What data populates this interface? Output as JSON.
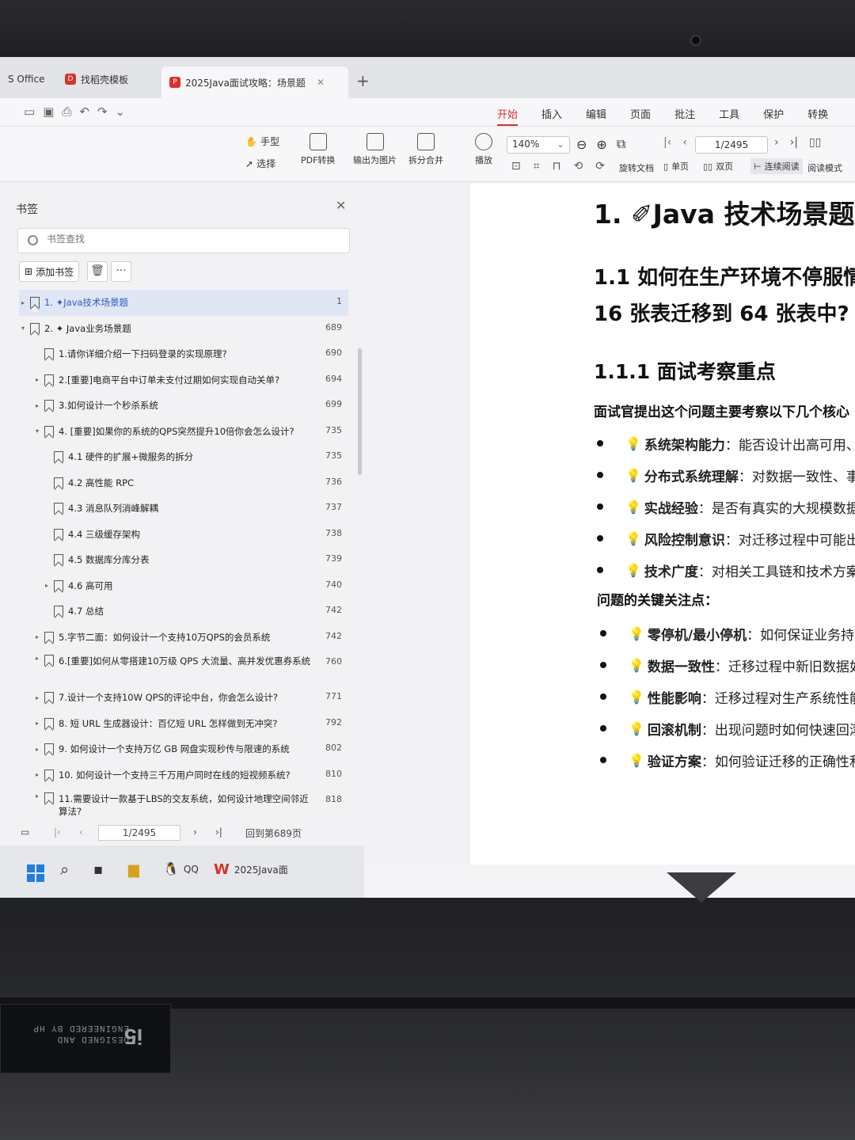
{
  "tabs": [
    {
      "label": "S Office"
    },
    {
      "label": "找稻壳模板"
    },
    {
      "label": "2025Java面试攻略：场景题"
    }
  ],
  "menu": [
    "开始",
    "插入",
    "编辑",
    "页面",
    "批注",
    "工具",
    "保护",
    "转换"
  ],
  "toolbar": {
    "hand": "手型",
    "select": "选择",
    "pdf_convert": "PDF转换",
    "export_image": "输出为图片",
    "split_merge": "拆分合并",
    "play": "播放",
    "zoom": "140%",
    "rotate": "旋转文档",
    "single": "单页",
    "double": "双页",
    "continuous": "连续阅读",
    "read_mode": "阅读模式",
    "page": "1/2495"
  },
  "bookmark_panel": {
    "title": "书签",
    "search_placeholder": "书签查找",
    "add_label": "添加书签",
    "items": [
      {
        "label": "1. ✦Java技术场景题",
        "page": "1"
      },
      {
        "label": "2. ✦ Java业务场景题",
        "page": "689"
      },
      {
        "label": "1.请你详细介绍一下扫码登录的实现原理?",
        "page": "690"
      },
      {
        "label": "2.[重要]电商平台中订单未支付过期如何实现自动关单?",
        "page": "694"
      },
      {
        "label": "3.如何设计一个秒杀系统",
        "page": "699"
      },
      {
        "label": "4. [重要]如果你的系统的QPS突然提升10倍你会怎么设计?",
        "page": "735"
      },
      {
        "label": "4.1 硬件的扩展+微服务的拆分",
        "page": "735"
      },
      {
        "label": "4.2 高性能 RPC",
        "page": "736"
      },
      {
        "label": "4.3 消息队列消峰解耦",
        "page": "737"
      },
      {
        "label": "4.4 三级缓存架构",
        "page": "738"
      },
      {
        "label": "4.5 数据库分库分表",
        "page": "739"
      },
      {
        "label": "4.6 高可用",
        "page": "740"
      },
      {
        "label": "4.7 总结",
        "page": "742"
      },
      {
        "label": "5.字节二面：如何设计一个支持10万QPS的会员系统",
        "page": "742"
      },
      {
        "label": "6.[重要]如何从零搭建10万级 QPS 大流量、高并发优惠券系统",
        "page": "760"
      },
      {
        "label": "7.设计一个支持10W QPS的评论中台，你会怎么设计?",
        "page": "771"
      },
      {
        "label": "8. 短 URL 生成器设计：百亿短 URL 怎样做到无冲突?",
        "page": "792"
      },
      {
        "label": "9. 如何设计一个支持万亿 GB 网盘实现秒传与限速的系统",
        "page": "802"
      },
      {
        "label": "10. 如何设计一个支持三千万用户同时在线的短视频系统?",
        "page": "810"
      },
      {
        "label": "11.需要设计一款基于LBS的交友系统，如何设计地理空间邻近算法?",
        "page": "818"
      }
    ],
    "pager_value": "1/2495",
    "goto_label": "回到第689页"
  },
  "taskbar": {
    "qq": "QQ",
    "wps": "2025Java面"
  },
  "document": {
    "h1": "1.  ✐Java 技术场景题",
    "h2_line1": "1.1  如何在生产环境不停服情",
    "h2_line2": "16 张表迁移到 64 张表中?",
    "h3": "1.1.1  面试考察重点",
    "lead": "面试官提出这个问题主要考察以下几个核心",
    "points": [
      {
        "b": "系统架构能力",
        "t": "：能否设计出高可用、"
      },
      {
        "b": "分布式系统理解",
        "t": "：对数据一致性、事"
      },
      {
        "b": "实战经验",
        "t": "：是否有真实的大规模数据"
      },
      {
        "b": "风险控制意识",
        "t": "：对迁移过程中可能出"
      },
      {
        "b": "技术广度",
        "t": "：对相关工具链和技术方案"
      }
    ],
    "lead2": "问题的关键关注点：",
    "points2": [
      {
        "b": "零停机/最小停机",
        "t": "：如何保证业务持"
      },
      {
        "b": "数据一致性",
        "t": "：迁移过程中新旧数据如"
      },
      {
        "b": "性能影响",
        "t": "：迁移过程对生产系统性能"
      },
      {
        "b": "回滚机制",
        "t": "：出现问题时如何快速回滚"
      },
      {
        "b": "验证方案",
        "t": "：如何验证迁移的正确性和"
      }
    ]
  },
  "sticker": {
    "text": "DESIGNED AND ENGINEERED BY HP"
  }
}
